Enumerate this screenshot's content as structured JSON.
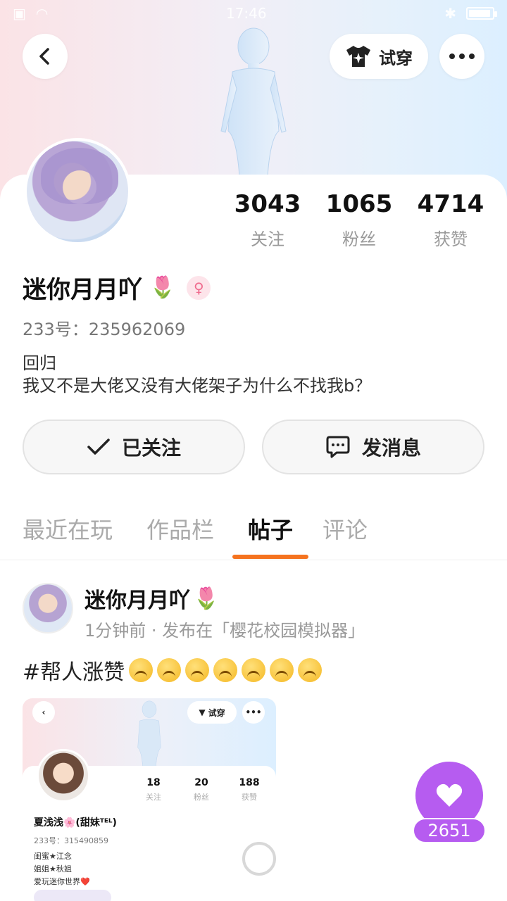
{
  "status_bar": {
    "time": "17:46"
  },
  "header": {
    "try_on_label": "试穿"
  },
  "profile": {
    "stats": [
      {
        "value": "3043",
        "label": "关注"
      },
      {
        "value": "1065",
        "label": "粉丝"
      },
      {
        "value": "4714",
        "label": "获赞"
      }
    ],
    "username": "迷你月月吖",
    "username_emoji": "🌷",
    "gender_symbol": "♀",
    "uid": "233号：235962069",
    "bio_line1": "回归",
    "bio_line2": "我又不是大佬又没有大佬架子为什么不找我b？"
  },
  "actions": {
    "follow_label": "已关注",
    "message_label": "发消息"
  },
  "tabs": [
    {
      "label": "最近在玩"
    },
    {
      "label": "作品栏"
    },
    {
      "label": "帖子"
    },
    {
      "label": "评论"
    }
  ],
  "post": {
    "author": "迷你月月吖",
    "author_emoji": "🌷",
    "meta": "1分钟前 · 发布在「樱花校园模拟器」",
    "text": "#帮人涨赞",
    "emoji_count": 7
  },
  "embed": {
    "try_on_label": "试穿",
    "stats": [
      {
        "value": "18",
        "label": "关注"
      },
      {
        "value": "20",
        "label": "粉丝"
      },
      {
        "value": "188",
        "label": "获赞"
      }
    ],
    "name": "夏浅浅🌸(甜妹ᵀᴱᴸ)",
    "uid": "233号：315490859",
    "bio_line1": "闺蜜★江念",
    "bio_line2": "姐姐★秋姐",
    "bio_line3": "爱玩迷你世界❤️"
  },
  "like": {
    "count": "2651"
  },
  "colors": {
    "accent": "#f5731f",
    "like": "#b65cf0"
  }
}
